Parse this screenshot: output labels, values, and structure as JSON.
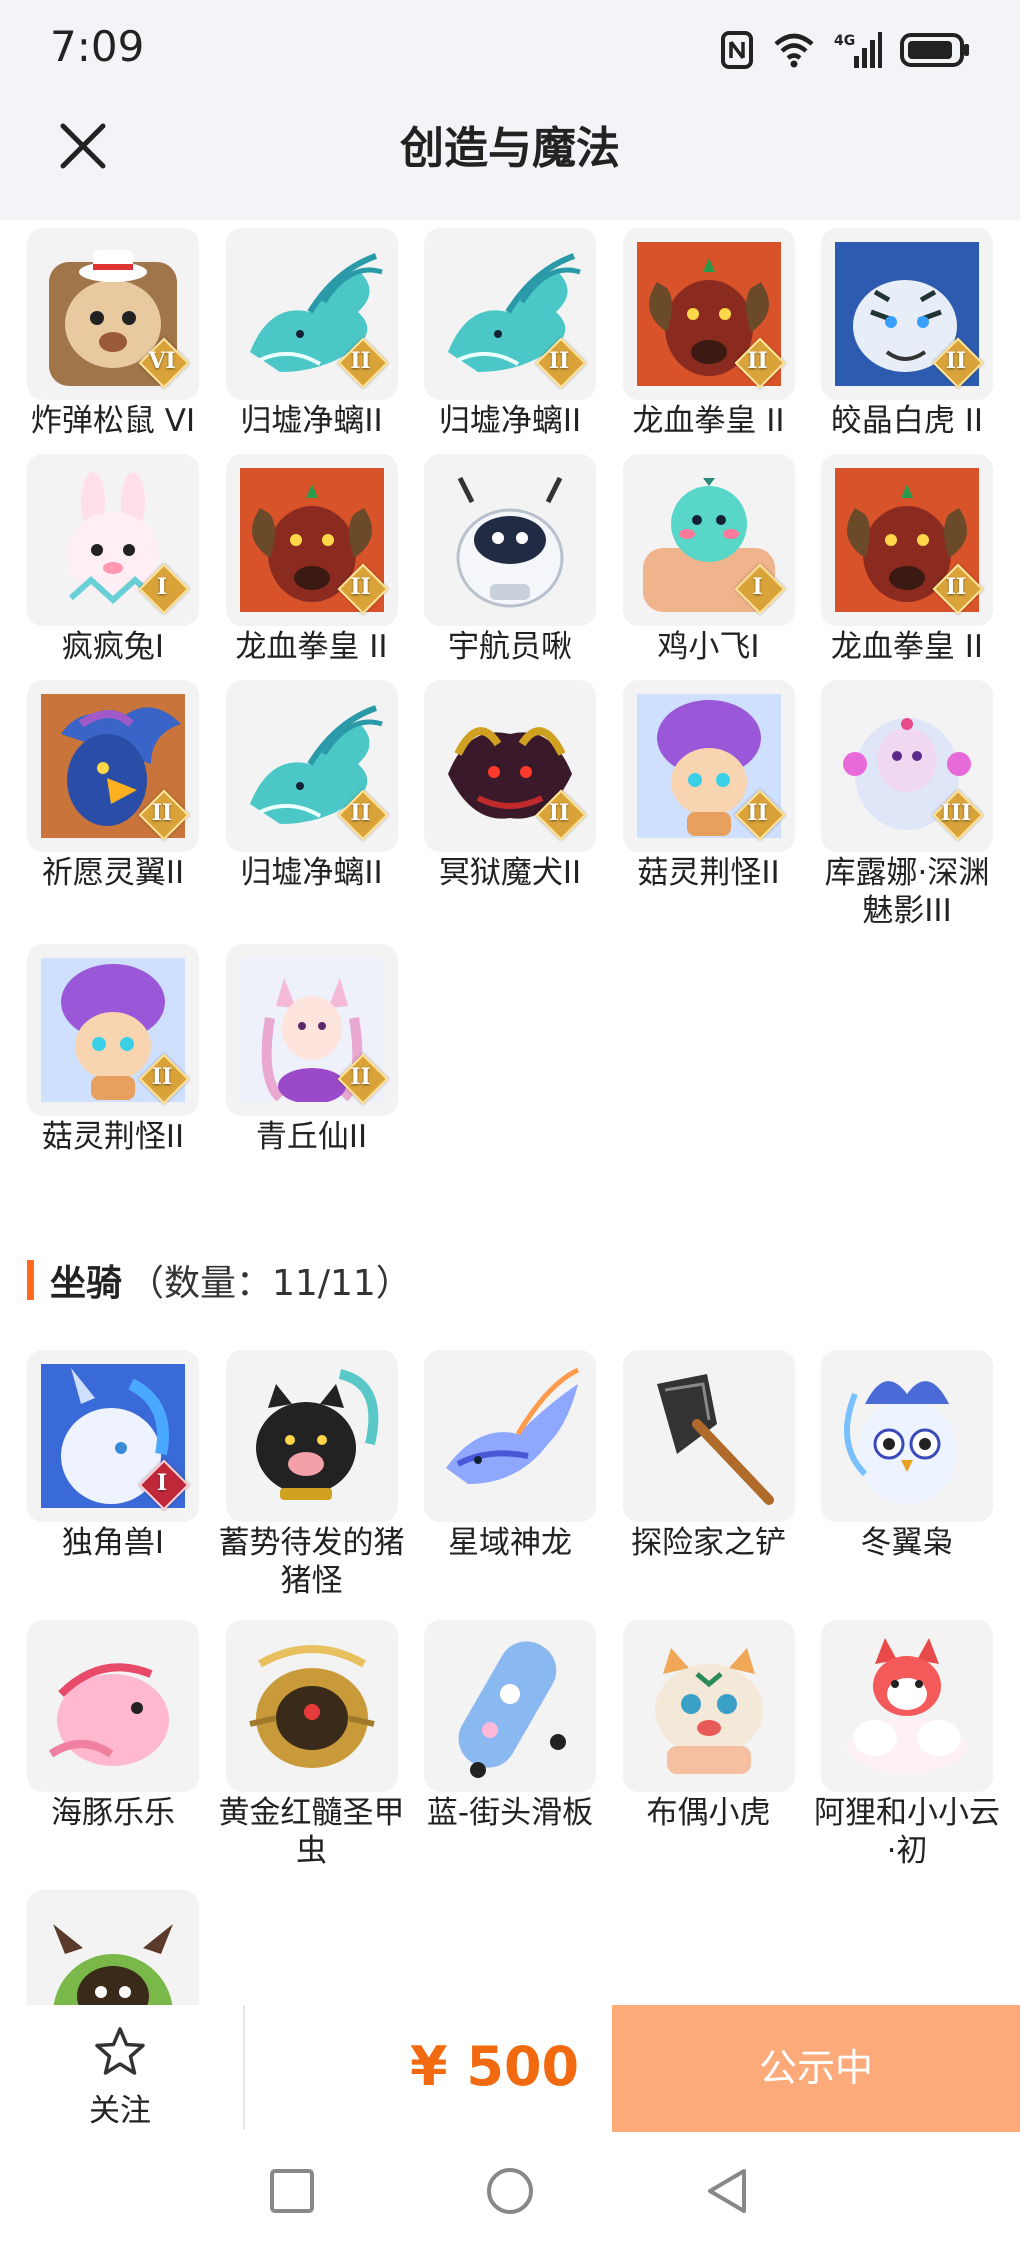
{
  "status_bar": {
    "time": "7:09",
    "network": "4G"
  },
  "header": {
    "title": "创造与魔法"
  },
  "pets": [
    {
      "name": "炸弹松鼠 VI",
      "badge": "VI",
      "art": "squirrel"
    },
    {
      "name": "归墟净螭II",
      "badge": "II",
      "art": "cyan-dragon"
    },
    {
      "name": "归墟净螭II",
      "badge": "II",
      "art": "cyan-dragon"
    },
    {
      "name": "龙血拳皇 II",
      "badge": "II",
      "art": "red-ram"
    },
    {
      "name": "皎晶白虎 II",
      "badge": "II",
      "art": "white-tiger"
    },
    {
      "name": "疯疯兔I",
      "badge": "I",
      "art": "rabbit"
    },
    {
      "name": "龙血拳皇 II",
      "badge": "II",
      "art": "red-ram"
    },
    {
      "name": "宇航员啾",
      "badge": "",
      "art": "astronaut"
    },
    {
      "name": "鸡小飞I",
      "badge": "I",
      "art": "bird"
    },
    {
      "name": "龙血拳皇 II",
      "badge": "II",
      "art": "red-ram"
    },
    {
      "name": "祈愿灵翼II",
      "badge": "II",
      "art": "eagle"
    },
    {
      "name": "归墟净螭II",
      "badge": "II",
      "art": "cyan-dragon"
    },
    {
      "name": "冥狱魔犬II",
      "badge": "II",
      "art": "hellhound"
    },
    {
      "name": "菇灵荆怪II",
      "badge": "II",
      "art": "mushroom"
    },
    {
      "name": "库露娜·深渊魅影III",
      "badge": "III",
      "art": "phantom"
    },
    {
      "name": "菇灵荆怪II",
      "badge": "II",
      "art": "mushroom"
    },
    {
      "name": "青丘仙II",
      "badge": "II",
      "art": "fox-fairy"
    }
  ],
  "mounts_section": {
    "title": "坐骑",
    "count_text": "（数量：11/11）"
  },
  "mounts": [
    {
      "name": "独角兽I",
      "badge": "I",
      "art": "unicorn"
    },
    {
      "name": "蓄势待发的猪猪怪",
      "badge": "",
      "art": "pig"
    },
    {
      "name": "星域神龙",
      "badge": "",
      "art": "star-dragon"
    },
    {
      "name": "探险家之铲",
      "badge": "",
      "art": "shovel"
    },
    {
      "name": "冬翼枭",
      "badge": "",
      "art": "owl"
    },
    {
      "name": "海豚乐乐",
      "badge": "",
      "art": "dolphin"
    },
    {
      "name": "黄金红髓圣甲虫",
      "badge": "",
      "art": "beetle"
    },
    {
      "name": "蓝-街头滑板",
      "badge": "",
      "art": "skateboard"
    },
    {
      "name": "布偶小虎",
      "badge": "",
      "art": "tiger-doll"
    },
    {
      "name": "阿狸和小小云·初",
      "badge": "",
      "art": "fox-cloud"
    },
    {
      "name": "",
      "badge": "",
      "art": "green-cow"
    }
  ],
  "action_bar": {
    "follow_label": "关注",
    "price": "¥ 500",
    "status_button": "公示中"
  },
  "colors": {
    "accent": "#f26a10",
    "status_button_bg": "#fdaa7b",
    "header_bg": "#f2f4f7",
    "badge_gold": "#d9a33a"
  }
}
